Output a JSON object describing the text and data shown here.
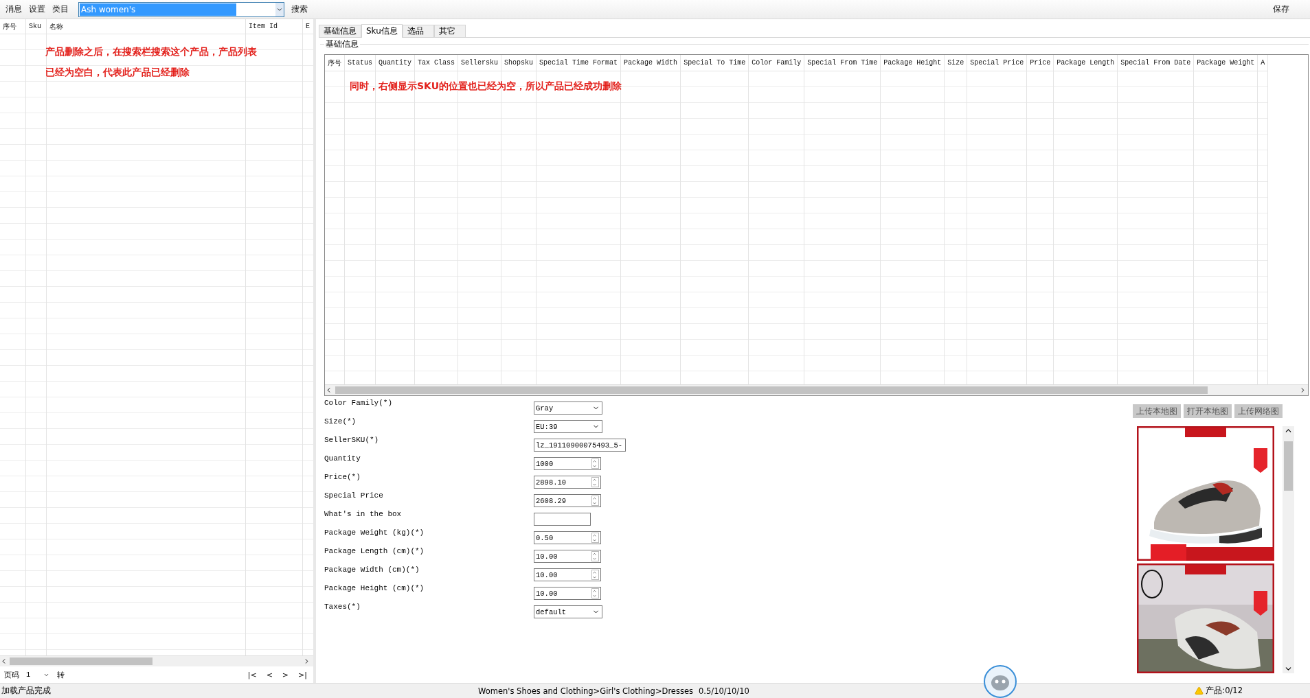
{
  "toolbar": {
    "menu": [
      "消息",
      "设置",
      "类目"
    ],
    "search": {
      "value": "Ash women's"
    },
    "search_button": "搜索",
    "save_button": "保存"
  },
  "product_list": {
    "columns": [
      "序号",
      "Sku",
      "名称",
      "Item Id",
      "E"
    ],
    "annotation": "产品删除之后，在搜索栏搜索这个产品，产品列表已经为空白，代表此产品已经删除",
    "pager": {
      "label": "页码",
      "page": "1",
      "go": "转",
      "nav": [
        "|<",
        "<",
        ">",
        ">|"
      ]
    }
  },
  "tabs": [
    {
      "label": "基础信息",
      "selected": false
    },
    {
      "label": "Sku信息",
      "selected": true
    },
    {
      "label": "选品",
      "selected": false
    },
    {
      "label": "其它",
      "selected": false
    }
  ],
  "sku_group": {
    "title": "基础信息",
    "columns": [
      "序号",
      "Status",
      "Quantity",
      "Tax Class",
      "Sellersku",
      "Shopsku",
      "Special Time Format",
      "Package Width",
      "Special To Time",
      "Color Family",
      "Special From Time",
      "Package Height",
      "Size",
      "Special Price",
      "Price",
      "Package Length",
      "Special From Date",
      "Package Weight",
      "A"
    ],
    "annotation": "同时，右侧显示SKU的位置也已经为空，所以产品已经成功删除"
  },
  "form": [
    {
      "kind": "select",
      "label": "Color Family(*)",
      "value": "Gray"
    },
    {
      "kind": "select",
      "label": "Size(*)",
      "value": "EU:39"
    },
    {
      "kind": "text",
      "label": "SellerSKU(*)",
      "value": "lz_19110900075493_5-"
    },
    {
      "kind": "spin",
      "label": "Quantity",
      "value": "1000"
    },
    {
      "kind": "spin",
      "label": "Price(*)",
      "value": "2898.10"
    },
    {
      "kind": "spin",
      "label": "Special Price",
      "value": "2608.29"
    },
    {
      "kind": "text",
      "label": "What's in the box"
    },
    {
      "kind": "spin",
      "label": "Package Weight (kg)(*)",
      "value": "0.50"
    },
    {
      "kind": "spin",
      "label": "Package Length (cm)(*)",
      "value": "10.00"
    },
    {
      "kind": "spin",
      "label": "Package Width (cm)(*)",
      "value": "10.00"
    },
    {
      "kind": "spin",
      "label": "Package Height (cm)(*)",
      "value": "10.00"
    },
    {
      "kind": "select",
      "label": "Taxes(*)",
      "value": "default"
    }
  ],
  "image_buttons": [
    "上传本地图",
    "打开本地图",
    "上传网络图"
  ],
  "images": [
    {
      "kind": "picture"
    },
    {
      "kind": "picture"
    }
  ],
  "status_bar": {
    "left": "加载产品完成",
    "category": "Women's Shoes and Clothing>Girl's Clothing>Dresses",
    "dims": "0.5/10/10/10",
    "right": "产品:0/12"
  }
}
